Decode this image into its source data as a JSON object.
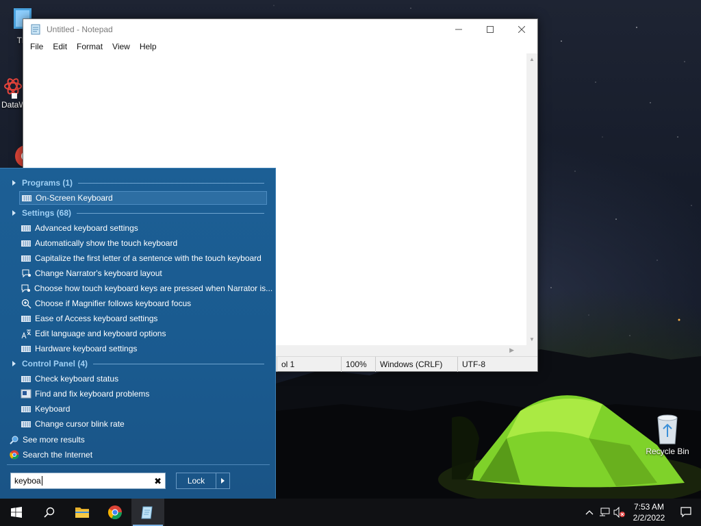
{
  "desktop": {
    "icons": [
      {
        "label": "Thi"
      },
      {
        "label": "DataW"
      },
      {
        "label": ""
      },
      {
        "label": "Recycle Bin"
      }
    ]
  },
  "notepad": {
    "title": "Untitled - Notepad",
    "menu": [
      "File",
      "Edit",
      "Format",
      "View",
      "Help"
    ],
    "status": {
      "position": "ol 1",
      "zoom": "100%",
      "line_endings": "Windows (CRLF)",
      "encoding": "UTF-8"
    }
  },
  "start_panel": {
    "groups": [
      {
        "header": "Programs (1)",
        "items": [
          {
            "label": "On-Screen Keyboard",
            "icon": "keyboard-icon",
            "selected": true
          }
        ]
      },
      {
        "header": "Settings (68)",
        "items": [
          {
            "label": "Advanced keyboard settings",
            "icon": "keyboard-icon"
          },
          {
            "label": "Automatically show the touch keyboard",
            "icon": "keyboard-icon"
          },
          {
            "label": "Capitalize the first letter of a sentence with the touch keyboard",
            "icon": "keyboard-icon"
          },
          {
            "label": "Change Narrator's keyboard layout",
            "icon": "narrator-icon"
          },
          {
            "label": "Choose how touch keyboard keys are pressed when Narrator is...",
            "icon": "narrator-icon"
          },
          {
            "label": "Choose if Magnifier follows keyboard focus",
            "icon": "magnifier-icon"
          },
          {
            "label": "Ease of Access keyboard settings",
            "icon": "keyboard-icon"
          },
          {
            "label": "Edit language and keyboard options",
            "icon": "language-icon"
          },
          {
            "label": "Hardware keyboard settings",
            "icon": "keyboard-icon"
          }
        ]
      },
      {
        "header": "Control Panel (4)",
        "items": [
          {
            "label": "Check keyboard status",
            "icon": "keyboard-icon"
          },
          {
            "label": "Find and fix keyboard problems",
            "icon": "troubleshoot-icon"
          },
          {
            "label": "Keyboard",
            "icon": "keyboard-icon"
          },
          {
            "label": "Change cursor blink rate",
            "icon": "keyboard-icon"
          }
        ]
      }
    ],
    "see_more": "See more results",
    "search_internet": "Search the Internet",
    "search_value": "keyboa",
    "lock_label": "Lock"
  },
  "taskbar": {
    "time": "7:53 AM",
    "date": "2/2/2022"
  },
  "colors": {
    "panel_blue": "#1a5a8f",
    "group_header": "#9fd0f5",
    "taskbar": "#101114"
  }
}
